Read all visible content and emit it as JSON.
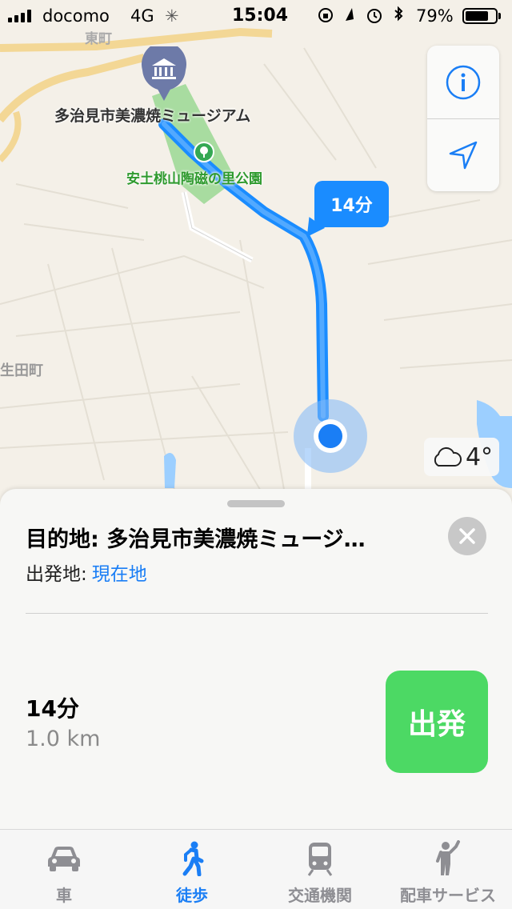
{
  "status_bar": {
    "carrier": "docomo",
    "network": "4G",
    "time": "15:04",
    "battery": "79%",
    "battery_level": 0.79
  },
  "map": {
    "museum_label": "多治見市美濃焼ミュージアム",
    "park_label": "安土桃山陶磁の里公園",
    "town_label_top": "東町",
    "town_label_left": "生田町",
    "route_eta": "14分",
    "weather_temp": "4°",
    "weather_icon": "cloud-icon",
    "route_color": "#1a8cff",
    "park_color": "#a8dca0"
  },
  "sheet": {
    "destination_title": "目的地: 多治見市美濃焼ミュージ…",
    "origin_prefix": "出発地:",
    "origin_value": "現在地",
    "duration": "14分",
    "distance": "1.0 km",
    "go_label": "出発",
    "go_color": "#4cd964"
  },
  "tabs": [
    {
      "label": "車",
      "icon": "car-icon",
      "active": false
    },
    {
      "label": "徒歩",
      "icon": "walk-icon",
      "active": true
    },
    {
      "label": "交通機関",
      "icon": "train-icon",
      "active": false
    },
    {
      "label": "配車サービス",
      "icon": "person-hail-icon",
      "active": false
    }
  ]
}
